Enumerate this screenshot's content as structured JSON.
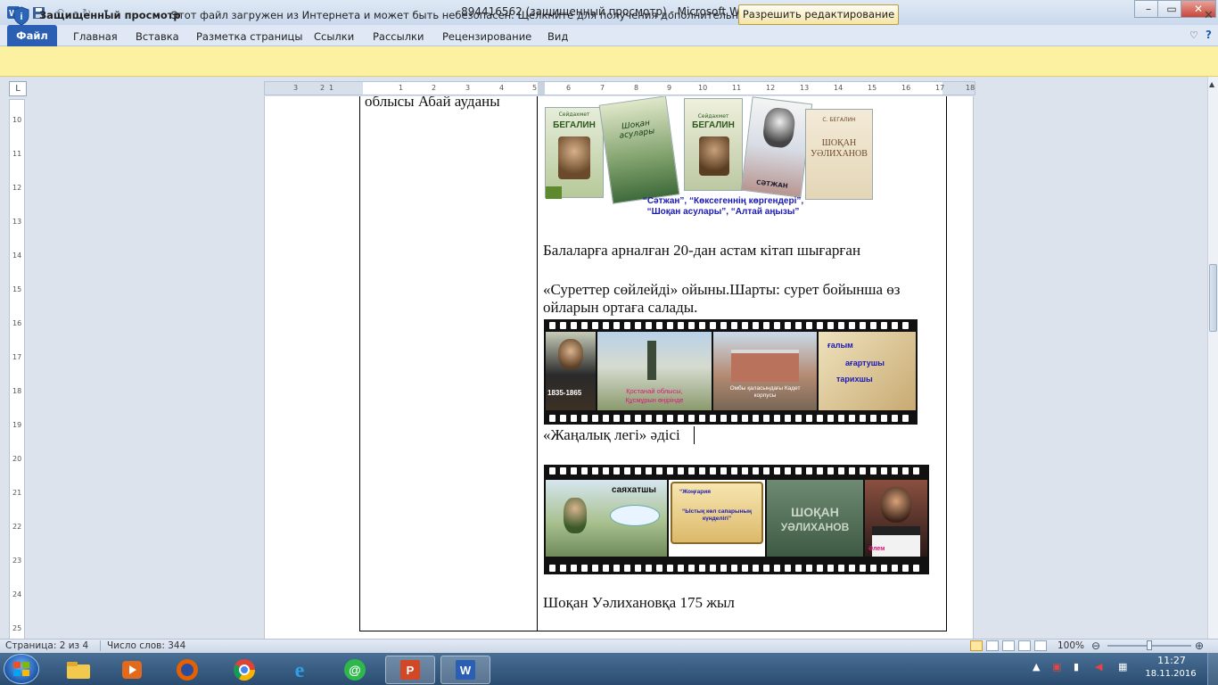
{
  "window": {
    "title": "894416562 (защищенный просмотр)  -  Microsoft Word"
  },
  "ribbon": {
    "file_tab": "Файл",
    "tabs": [
      "Главная",
      "Вставка",
      "Разметка страницы",
      "Ссылки",
      "Рассылки",
      "Рецензирование",
      "Вид"
    ]
  },
  "protected_view": {
    "title": "Защищенный просмотр",
    "message": "Этот файл загружен из Интернета и может быть небезопасен. Щелкните для получения дополнительных сведений.",
    "enable_button": "Разрешить редактирование"
  },
  "ruler": {
    "h_marks": [
      "3",
      "2",
      "1",
      "1",
      "2",
      "3",
      "4",
      "5",
      "6",
      "7",
      "8",
      "9",
      "10",
      "11",
      "12",
      "13",
      "14",
      "15",
      "16",
      "17",
      "18"
    ],
    "v_marks": [
      "10",
      "11",
      "12",
      "13",
      "14",
      "15",
      "16",
      "17",
      "18",
      "19",
      "20",
      "21",
      "22",
      "23",
      "24",
      "25"
    ]
  },
  "document": {
    "left_cell_text": "облысы Абай ауданы",
    "books_caption_1": "“Сәтжан”, “Көксегеннің көргендері”,",
    "books_caption_2": "“Шоқан асулары”, “Алтай аңызы”",
    "para1": "Балаларға арналған 20-дан астам кітап  шығарған",
    "para2_line1": "«Суреттер сөйлейді» ойыны.Шарты: сурет бойынша өз",
    "para2_line2": "ойларын ортаға салады.",
    "film1": {
      "years": "1835-1865",
      "place_1": "Қостанай облысы,",
      "place_2": "Құсмұрын өңірінде",
      "school_1": "Омбы қаласындағы Кадет",
      "school_2": "корпусы",
      "word1": "ғалым",
      "word2": "ағартушы",
      "word3": "тарихшы"
    },
    "para3": "«Жаңалық легі» әдісі",
    "film2": {
      "traveler": "саяхатшы",
      "book_title1": "“Жоңғария",
      "book_title2": "“Ыстық көл сапарының",
      "book_title3": "күнделігі”",
      "movie_title1": "ШОҚАН",
      "movie_title2": "УӘЛИХАНОВ",
      "actor_label": "Әлем"
    },
    "para4": "Шоқан Уәлихановқа 175 жыл"
  },
  "books": {
    "b1_author": "Сейдахмет",
    "b1_title": "БЕГАЛИН",
    "b2_title": "Шоқан асулары",
    "b3_author": "Сейдахмет",
    "b3_title": "БЕГАЛИН",
    "b4_title": "СӘТЖАН",
    "b5_author": "С. БЕГАЛИН",
    "b5_title1": "ШОҚАН",
    "b5_title2": "УӘЛИХАНОВ"
  },
  "statusbar": {
    "page": "Страница: 2 из 4",
    "words": "Число слов: 344",
    "zoom": "100%"
  },
  "tray": {
    "time": "11:27",
    "date": "18.11.2016"
  },
  "colors": {
    "accent": "#2b5fb4",
    "protected_bar": "#fcf0a1",
    "caption_blue": "#1a1ab5",
    "magenta": "#e0157a"
  }
}
